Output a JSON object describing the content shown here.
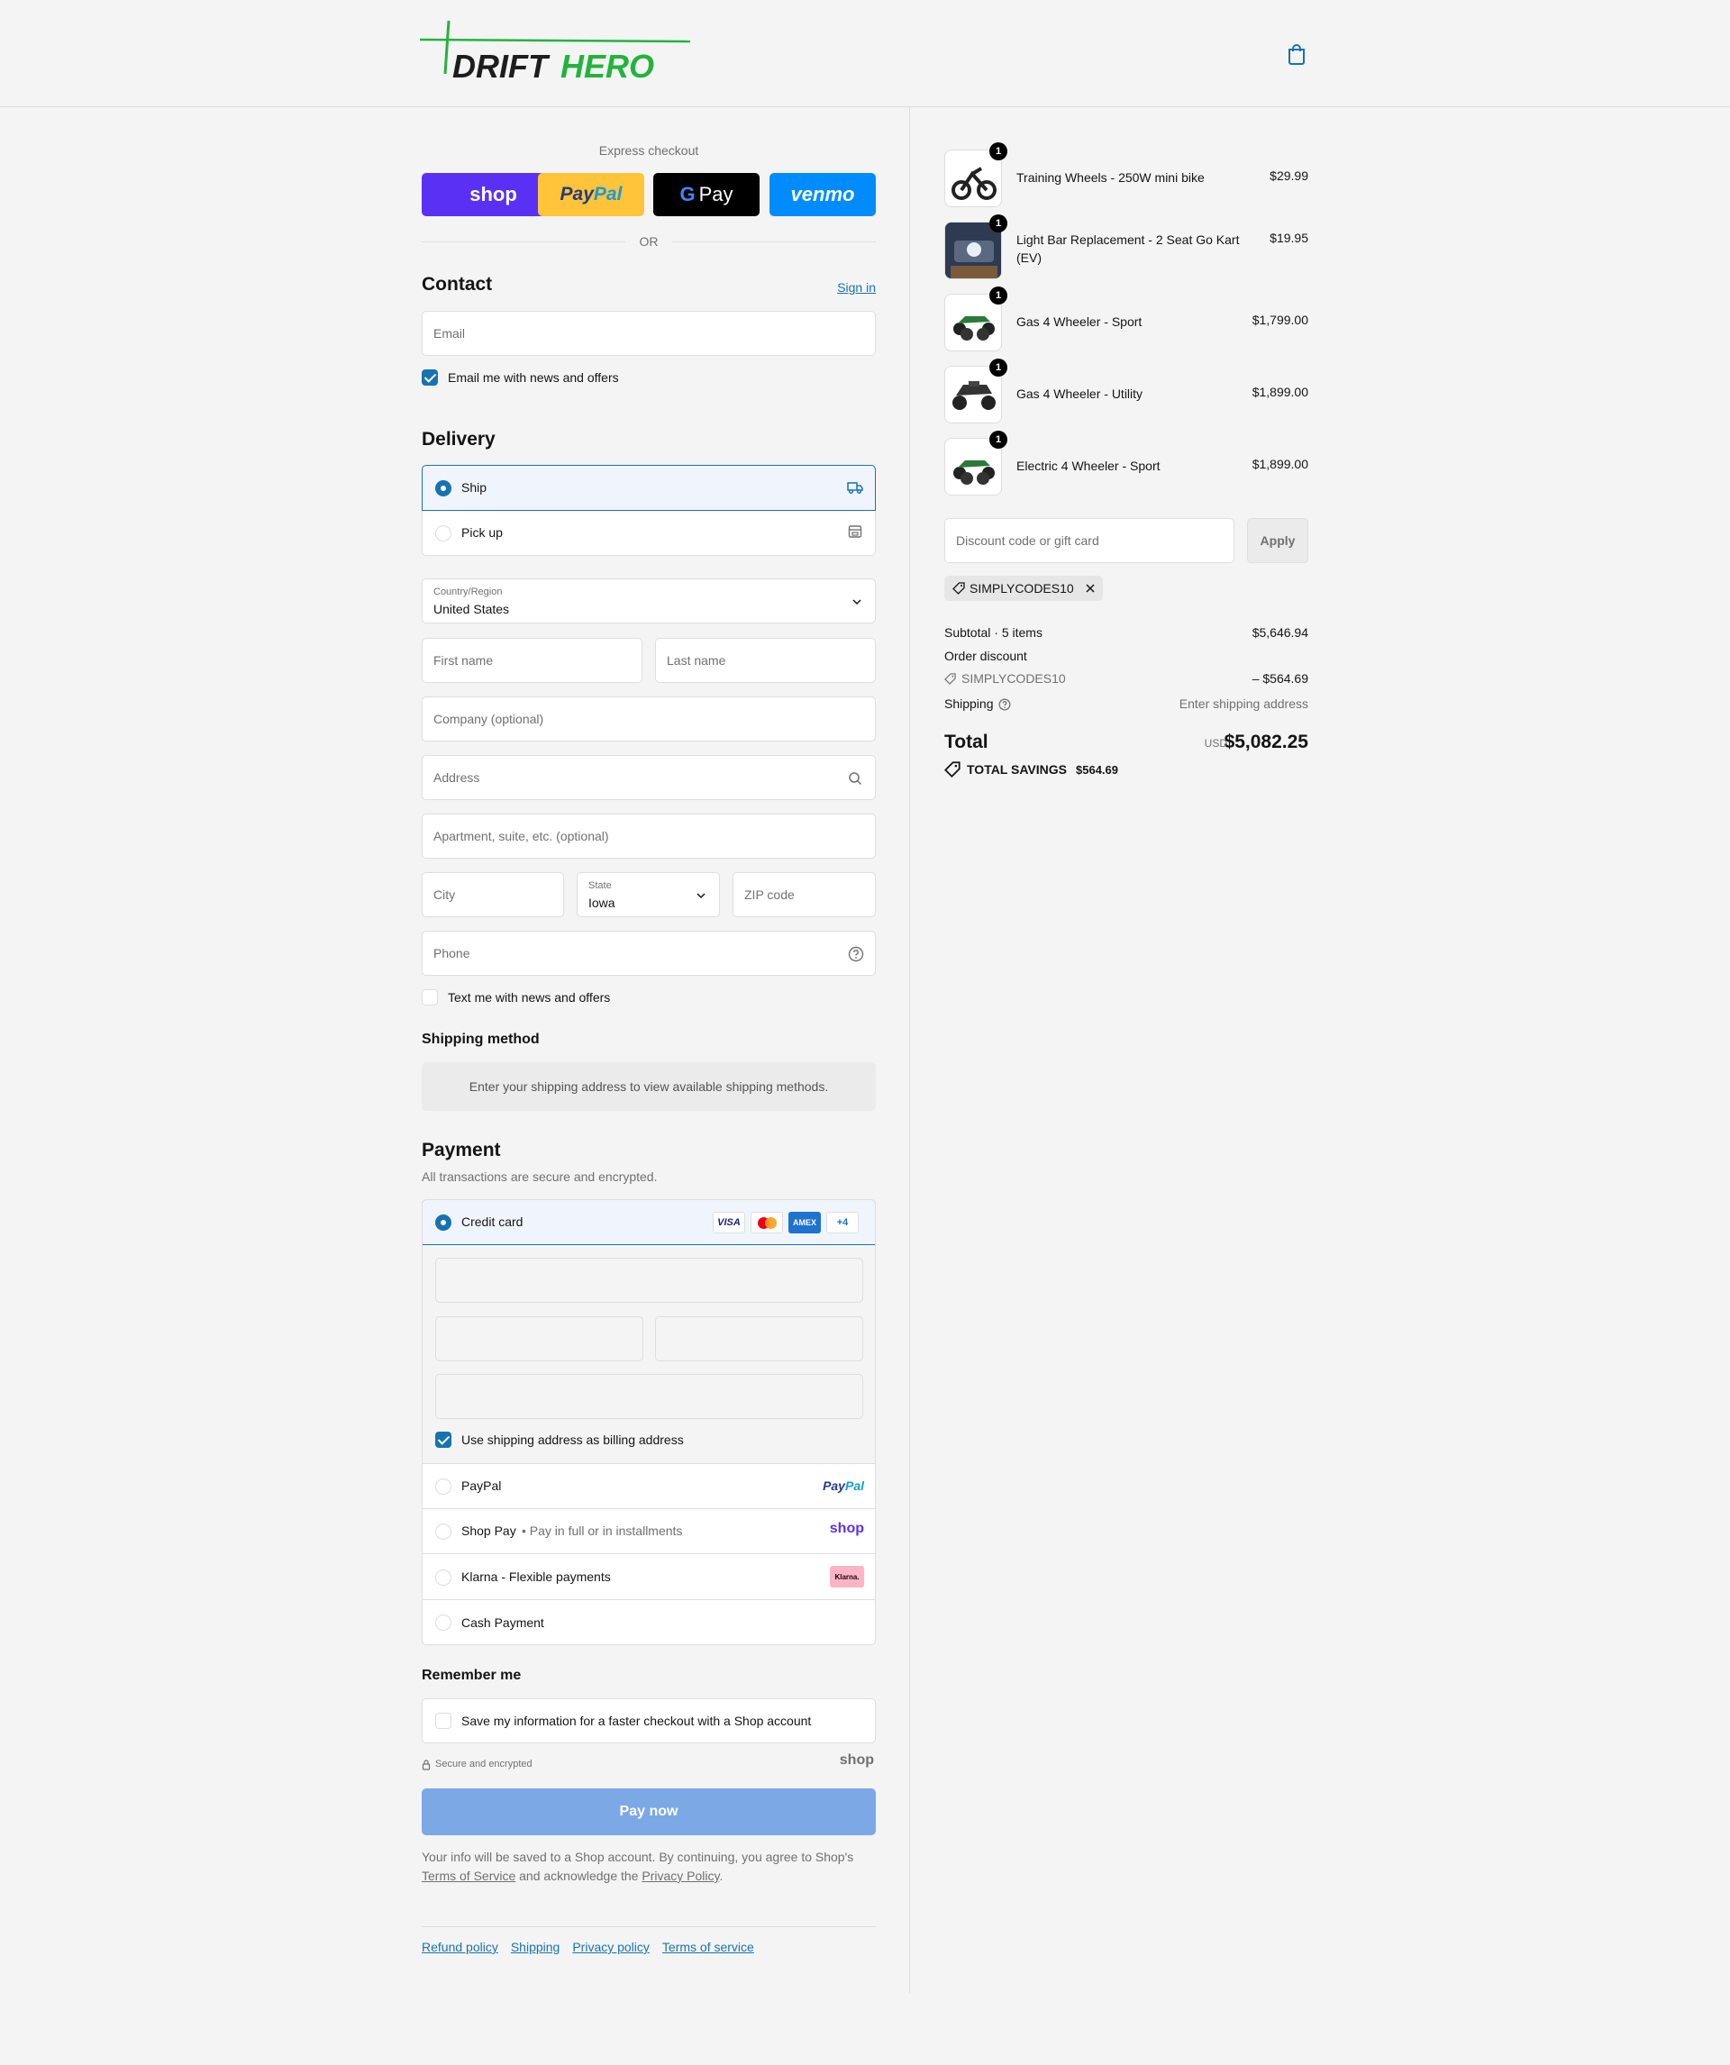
{
  "header": {
    "brand": {
      "part1": "DRIFT",
      "part2": "HERO"
    }
  },
  "express": {
    "title": "Express checkout",
    "buttons": {
      "shop": "shop",
      "paypal_a": "Pay",
      "paypal_b": "Pal",
      "gpay": "Pay",
      "venmo": "venmo"
    },
    "or": "OR"
  },
  "contact": {
    "title": "Contact",
    "sign_in": "Sign in",
    "email_placeholder": "Email",
    "news_label": "Email me with news and offers"
  },
  "delivery": {
    "title": "Delivery",
    "ship": "Ship",
    "pickup": "Pick up",
    "country_label": "Country/Region",
    "country_value": "United States",
    "first_name": "First name",
    "last_name": "Last name",
    "company": "Company (optional)",
    "address": "Address",
    "apartment": "Apartment, suite, etc. (optional)",
    "city": "City",
    "state_label": "State",
    "state_value": "Iowa",
    "zip": "ZIP code",
    "phone": "Phone",
    "text_label": "Text me with news and offers"
  },
  "shipping_method": {
    "title": "Shipping method",
    "info": "Enter your shipping address to view available shipping methods."
  },
  "payment": {
    "title": "Payment",
    "subtitle": "All transactions are secure and encrypted.",
    "credit_card": "Credit card",
    "card_brands": {
      "visa": "VISA",
      "amex": "AMEX",
      "more": "+4"
    },
    "billing_label": "Use shipping address as billing address",
    "paypal": "PayPal",
    "paypal_logo_a": "Pay",
    "paypal_logo_b": "Pal",
    "shop_pay": "Shop Pay",
    "shop_pay_sub": "Pay in full or in installments",
    "shop_logo": "shop",
    "klarna": "Klarna - Flexible payments",
    "klarna_logo": "Klarna.",
    "cash": "Cash Payment"
  },
  "remember": {
    "title": "Remember me",
    "save_label": "Save my information for a faster checkout with a Shop account",
    "secure": "Secure and encrypted",
    "shop_logo": "shop"
  },
  "pay_now": "Pay now",
  "legal": {
    "line1": "Your info will be saved to a Shop account. By continuing, you agree to Shop's",
    "tos": "Terms of Service",
    "mid": "and acknowledge the",
    "privacy": "Privacy Policy",
    "end": "."
  },
  "footer": {
    "links": [
      "Refund policy",
      "Shipping",
      "Privacy policy",
      "Terms of service"
    ]
  },
  "summary": {
    "items": [
      {
        "name": "Training Wheels - 250W mini bike",
        "price": "$29.99",
        "qty": "1"
      },
      {
        "name": "Light Bar Replacement - 2 Seat Go Kart (EV)",
        "price": "$19.95",
        "qty": "1"
      },
      {
        "name": "Gas 4 Wheeler - Sport",
        "price": "$1,799.00",
        "qty": "1"
      },
      {
        "name": "Gas 4 Wheeler - Utility",
        "price": "$1,899.00",
        "qty": "1"
      },
      {
        "name": "Electric 4 Wheeler - Sport",
        "price": "$1,899.00",
        "qty": "1"
      }
    ],
    "discount_placeholder": "Discount code or gift card",
    "apply": "Apply",
    "code": "SIMPLYCODES10",
    "subtotal_label": "Subtotal · 5 items",
    "subtotal": "$5,646.94",
    "order_discount": "Order discount",
    "discount_code": "SIMPLYCODES10",
    "discount_amount": "– $564.69",
    "shipping_label": "Shipping",
    "shipping_value": "Enter shipping address",
    "total_label": "Total",
    "currency": "USD",
    "total": "$5,082.25",
    "savings_label": "TOTAL SAVINGS",
    "savings": "$564.69"
  },
  "colors": {
    "accent": "#1773b0",
    "pay_now": "#7ca8e6",
    "brand_green": "#22b43a",
    "shop_purple": "#5a31f4",
    "paypal_yellow": "#ffc43a",
    "venmo_blue": "#008cff"
  }
}
